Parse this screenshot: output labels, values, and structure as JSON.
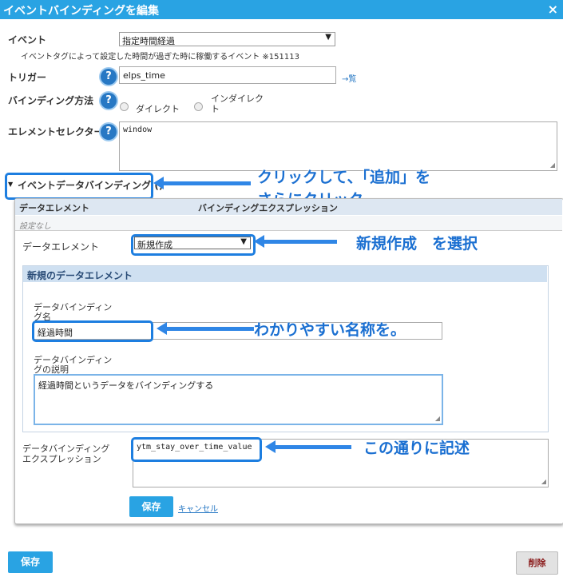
{
  "dialog": {
    "title": "イベントバインディングを編集",
    "close": "×"
  },
  "event": {
    "label": "イベント",
    "value": "指定時間経過",
    "note": "イベントタグによって設定した時間が過ぎた時に稼働するイベント ※151113"
  },
  "trigger": {
    "label": "トリガー",
    "value": "elps_time",
    "link": "→覧"
  },
  "binding_method": {
    "label": "バインディング方法",
    "option1": "ダイレクト",
    "option2_line1": "インダイレク",
    "option2_line2": "ト"
  },
  "element_selector": {
    "label": "エレメントセレクター",
    "value": "window"
  },
  "section": {
    "label": "イベントデータバインディング ()"
  },
  "table": {
    "col1": "データエレメント",
    "col2": "バインディングエクスプレッション",
    "empty": "設定なし"
  },
  "data_element": {
    "label": "データエレメント",
    "value": "新規作成"
  },
  "new_element": {
    "header": "新規のデータエレメント",
    "name_label_1": "データバインディン",
    "name_label_2": "グ名",
    "name_value": "経過時間",
    "desc_label_1": "データバインディン",
    "desc_label_2": "グの説明",
    "desc_value": "経過時間というデータをバインディングする"
  },
  "expression": {
    "label_1": "データバインディング",
    "label_2": "エクスプレッション",
    "value": "ytm_stay_over_time_value"
  },
  "buttons": {
    "save_inner": "保存",
    "cancel": "キャンセル",
    "save": "保存",
    "delete": "削除"
  },
  "callouts": {
    "c1_line1": "クリックして、「追加」を",
    "c1_line2": "さらにクリック",
    "c2": "新規作成　を選択",
    "c3": "わかりやすい名称を。",
    "c4": "この通りに記述"
  },
  "colors": {
    "accent": "#29a3e3",
    "annotation": "#1d7ee0"
  }
}
